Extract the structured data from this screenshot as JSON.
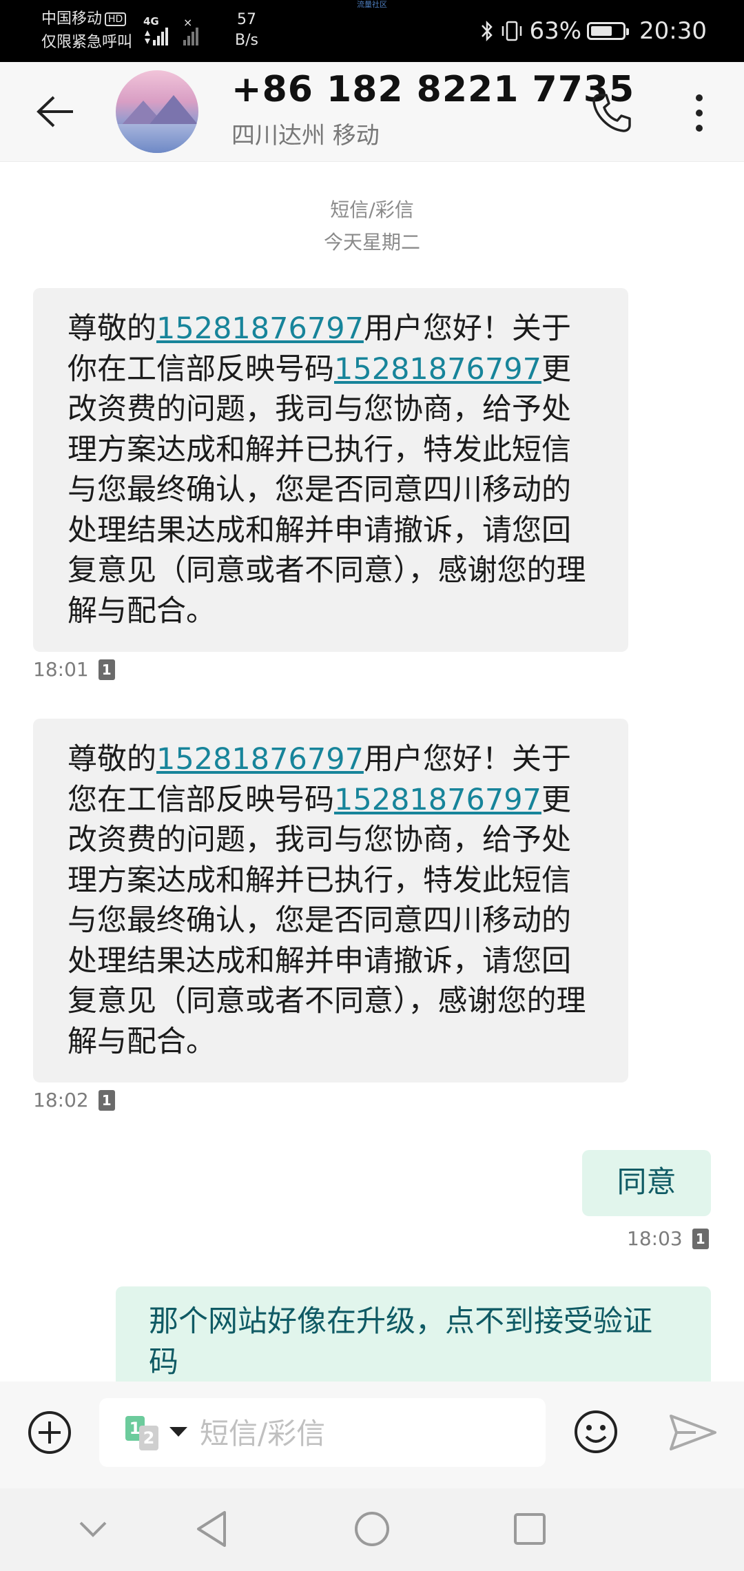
{
  "status_bar": {
    "carrier": "中国移动",
    "hd": "HD",
    "emergency": "仅限紧急呼叫",
    "network": "4G",
    "speed_value": "57",
    "speed_unit": "B/s",
    "top_text": "流量社区",
    "battery": "63%",
    "time": "20:30"
  },
  "header": {
    "contact": "+86 182 8221 7735",
    "location": "四川达州 移动"
  },
  "conversation": {
    "type_label": "短信/彩信",
    "date_label": "今天星期二",
    "messages": [
      {
        "pre": "尊敬的",
        "link1": "15281876797",
        "mid": "用户您好！关于你在工信部反映号码",
        "link2": "15281876797",
        "post": "更改资费的问题，我司与您协商，给予处理方案达成和解并已执行，特发此短信与您最终确认，您是否同意四川移动的处理结果达成和解并申请撤诉，请您回复意见（同意或者不同意），感谢您的理解与配合。",
        "time": "18:01",
        "sim": "1"
      },
      {
        "pre": "尊敬的",
        "link1": "15281876797",
        "mid": "用户您好！关于您在工信部反映号码",
        "link2": "15281876797",
        "post": "更改资费的问题，我司与您协商，给予处理方案达成和解并已执行，特发此短信与您最终确认，您是否同意四川移动的处理结果达成和解并申请撤诉，请您回复意见（同意或者不同意），感谢您的理解与配合。",
        "time": "18:02",
        "sim": "1"
      }
    ],
    "sent": [
      {
        "text": "同意",
        "time": "18:03",
        "sim": "1"
      },
      {
        "text": "那个网站好像在升级，点不到接受验证码"
      }
    ]
  },
  "composer": {
    "placeholder": "短信/彩信",
    "sim_primary": "1",
    "sim_secondary": "2"
  },
  "colors": {
    "link": "#17849a",
    "incoming_bubble": "#f1f1f1",
    "outgoing_bubble": "#e1f5ec",
    "outgoing_text": "#0f5a64"
  }
}
